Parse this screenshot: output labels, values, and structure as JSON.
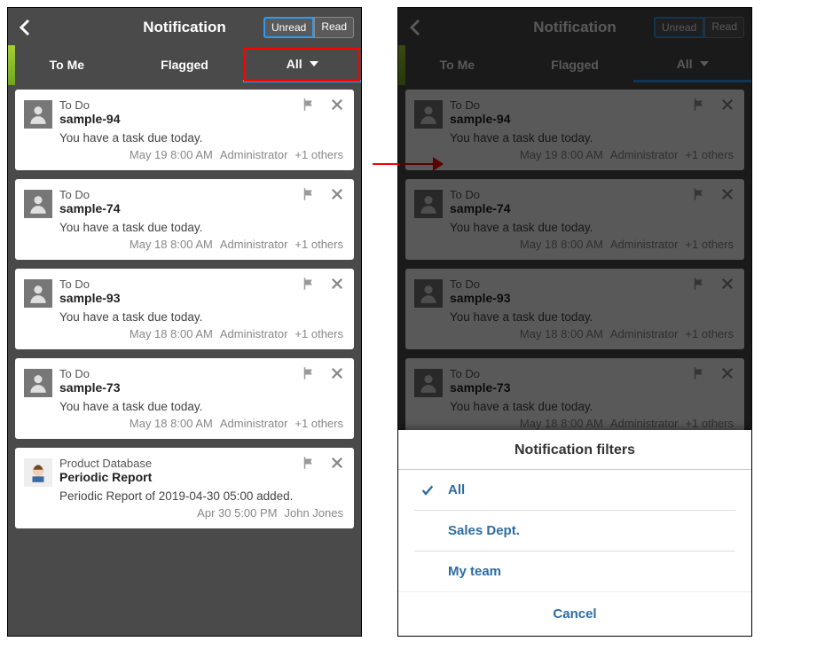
{
  "header": {
    "title": "Notification",
    "toggle_unread": "Unread",
    "toggle_read": "Read"
  },
  "tabs": {
    "tome": "To Me",
    "flagged": "Flagged",
    "all": "All"
  },
  "cards": [
    {
      "category": "To Do",
      "title": "sample-94",
      "msg": "You have a task due today.",
      "time": "May 19 8:00 AM",
      "user": "Administrator",
      "extra": "+1 others"
    },
    {
      "category": "To Do",
      "title": "sample-74",
      "msg": "You have a task due today.",
      "time": "May 18 8:00 AM",
      "user": "Administrator",
      "extra": "+1 others"
    },
    {
      "category": "To Do",
      "title": "sample-93",
      "msg": "You have a task due today.",
      "time": "May 18 8:00 AM",
      "user": "Administrator",
      "extra": "+1 others"
    },
    {
      "category": "To Do",
      "title": "sample-73",
      "msg": "You have a task due today.",
      "time": "May 18 8:00 AM",
      "user": "Administrator",
      "extra": "+1 others"
    },
    {
      "category": "Product Database",
      "title": "Periodic Report",
      "msg": "Periodic Report of 2019-04-30 05:00 added.",
      "time": "Apr 30 5:00 PM",
      "user": "John Jones",
      "extra": ""
    }
  ],
  "sheet": {
    "title": "Notification filters",
    "opt_all": "All",
    "opt_sales": "Sales Dept.",
    "opt_team": "My team",
    "cancel": "Cancel"
  }
}
